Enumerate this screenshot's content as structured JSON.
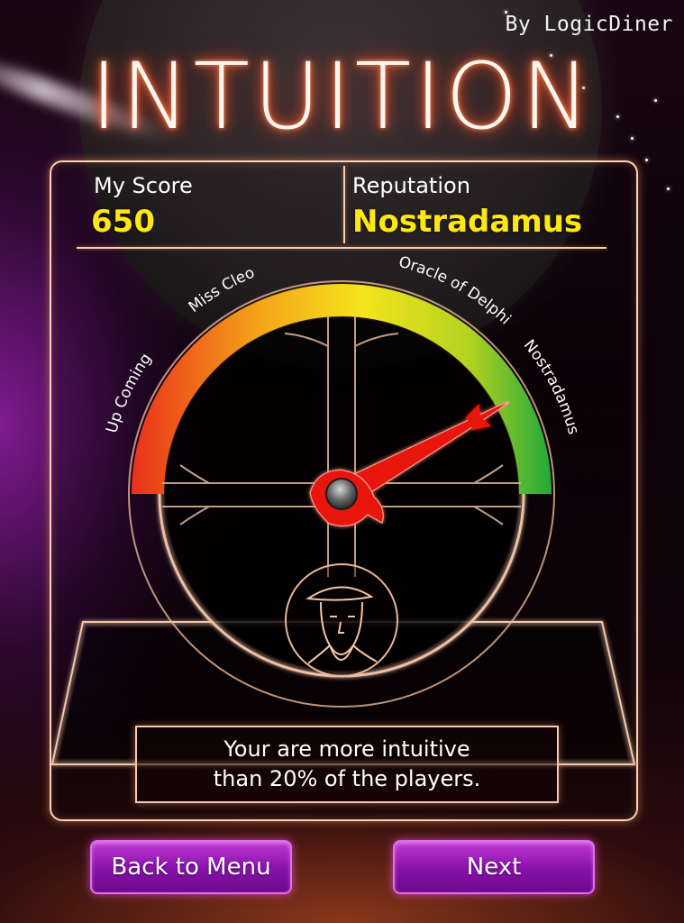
{
  "app": {
    "byline": "By LogicDiner",
    "title": "INTUITION"
  },
  "score": {
    "label": "My Score",
    "value": "650"
  },
  "reputation": {
    "label": "Reputation",
    "value": "Nostradamus"
  },
  "gauge": {
    "levels": [
      "Up Coming",
      "Miss Cleo",
      "Oracle of Delphi",
      "Nostradamus"
    ],
    "needle_fraction": 0.84,
    "colors": [
      "#e8311a",
      "#f6a21a",
      "#f4e41c",
      "#22a83a"
    ]
  },
  "result": {
    "line1": "Your are more intuitive",
    "line2": "than 20% of the players."
  },
  "buttons": {
    "back": "Back to Menu",
    "next": "Next"
  },
  "colors": {
    "score_value": "#ffe710",
    "button": "#8c12ad",
    "title_glow": "#ff5a2a"
  }
}
